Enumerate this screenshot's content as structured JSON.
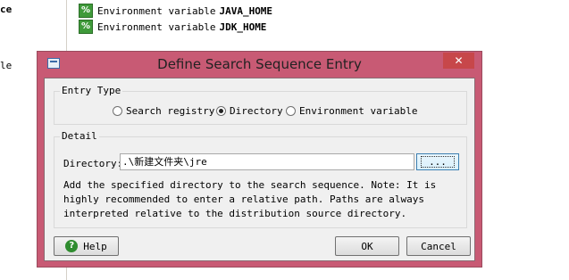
{
  "background": {
    "left_labels": [
      "ce",
      "le"
    ],
    "tree_items": [
      {
        "prefix": "Environment variable",
        "name": "JAVA_HOME",
        "icon": "percent-icon"
      },
      {
        "prefix": "Environment variable",
        "name": "JDK_HOME",
        "icon": "percent-icon"
      }
    ]
  },
  "dialog": {
    "title": "Define Search Sequence Entry",
    "close_symbol": "✕",
    "entry_type": {
      "label": "Entry Type",
      "options": [
        "Search registry",
        "Directory",
        "Environment variable"
      ],
      "selected": "Directory"
    },
    "detail": {
      "label": "Detail",
      "directory_label": "Directory:",
      "directory_value": ".\\新建文件夹\\jre",
      "browse_label": "...",
      "description": "Add the specified directory to the search sequence. Note: It is highly recommended to enter a relative path. Paths are always interpreted relative to the distribution source directory."
    },
    "buttons": {
      "help": "Help",
      "ok": "OK",
      "cancel": "Cancel"
    }
  },
  "colors": {
    "dialog_frame": "#c85a74",
    "close_button": "#c7474a",
    "client_bg": "#f0f0f0"
  }
}
